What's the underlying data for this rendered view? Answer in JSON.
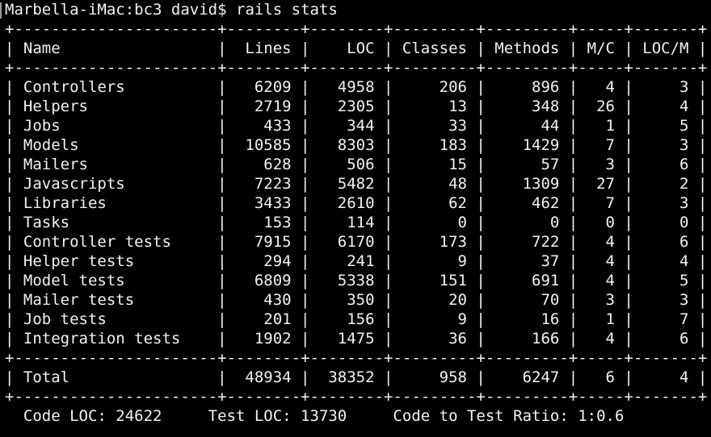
{
  "terminal": {
    "prompt": "Marbella-iMac:bc3 david$",
    "command": "rails stats",
    "separator": "+----------------------+--------+--------+---------+---------+-----+-------+",
    "header_row": "| Name                 |  Lines |    LOC | Classes | Methods | M/C | LOC/M |",
    "rows": [
      "| Controllers          |   6209 |   4958 |     206 |     896 |   4 |     3 |",
      "| Helpers              |   2719 |   2305 |      13 |     348 |  26 |     4 |",
      "| Jobs                 |    433 |    344 |      33 |      44 |   1 |     5 |",
      "| Models               |  10585 |   8303 |     183 |    1429 |   7 |     3 |",
      "| Mailers              |    628 |    506 |      15 |      57 |   3 |     6 |",
      "| Javascripts          |   7223 |   5482 |      48 |    1309 |  27 |     2 |",
      "| Libraries            |   3433 |   2610 |      62 |     462 |   7 |     3 |",
      "| Tasks                |    153 |    114 |       0 |       0 |   0 |     0 |",
      "| Controller tests     |   7915 |   6170 |     173 |     722 |   4 |     6 |",
      "| Helper tests         |    294 |    241 |       9 |      37 |   4 |     4 |",
      "| Model tests          |   6809 |   5338 |     151 |     691 |   4 |     5 |",
      "| Mailer tests         |    430 |    350 |      20 |      70 |   3 |     3 |",
      "| Job tests            |    201 |    156 |       9 |      16 |   1 |     7 |",
      "| Integration tests    |   1902 |   1475 |      36 |     166 |   4 |     6 |"
    ],
    "total_row": "| Total                |  48934 |  38352 |     958 |    6247 |   6 |     4 |",
    "summary": "  Code LOC: 24622     Test LOC: 13730     Code to Test Ratio: 1:0.6"
  }
}
